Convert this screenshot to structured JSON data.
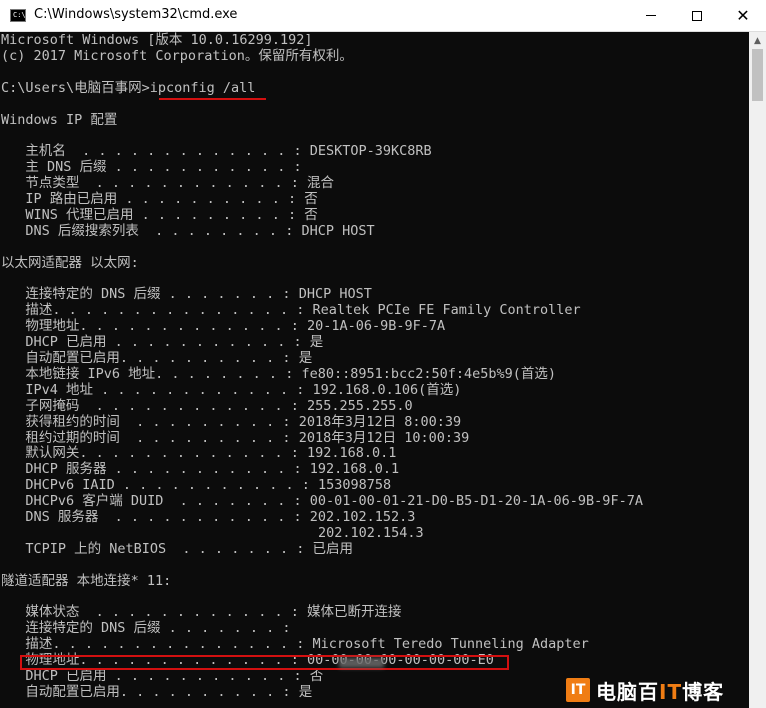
{
  "window": {
    "title": "C:\\Windows\\system32\\cmd.exe",
    "minimize_label": "—",
    "maximize_label": "☐",
    "close_label": "✕"
  },
  "console": {
    "lines": [
      "Microsoft Windows [版本 10.0.16299.192]",
      "(c) 2017 Microsoft Corporation。保留所有权利。",
      "",
      "C:\\Users\\电脑百事网>ipconfig /all",
      "",
      "Windows IP 配置",
      "",
      "   主机名  . . . . . . . . . . . . . : DESKTOP-39KC8RB",
      "   主 DNS 后缀 . . . . . . . . . . . :",
      "   节点类型  . . . . . . . . . . . . : 混合",
      "   IP 路由已启用 . . . . . . . . . . : 否",
      "   WINS 代理已启用 . . . . . . . . . : 否",
      "   DNS 后缀搜索列表  . . . . . . . . : DHCP HOST",
      "",
      "以太网适配器 以太网:",
      "",
      "   连接特定的 DNS 后缀 . . . . . . . : DHCP HOST",
      "   描述. . . . . . . . . . . . . . . : Realtek PCIe FE Family Controller",
      "   物理地址. . . . . . . . . . . . . : 20-1A-06-9B-9F-7A",
      "   DHCP 已启用 . . . . . . . . . . . : 是",
      "   自动配置已启用. . . . . . . . . . : 是",
      "   本地链接 IPv6 地址. . . . . . . . : fe80::8951:bcc2:50f:4e5b%9(首选)",
      "   IPv4 地址 . . . . . . . . . . . . : 192.168.0.106(首选)",
      "   子网掩码  . . . . . . . . . . . . : 255.255.255.0",
      "   获得租约的时间  . . . . . . . . . : 2018年3月12日 8:00:39",
      "   租约过期的时间  . . . . . . . . . : 2018年3月12日 10:00:39",
      "   默认网关. . . . . . . . . . . . . : 192.168.0.1",
      "   DHCP 服务器 . . . . . . . . . . . : 192.168.0.1",
      "   DHCPv6 IAID . . . . . . . . . . . : 153098758",
      "   DHCPv6 客户端 DUID  . . . . . . . : 00-01-00-01-21-D0-B5-D1-20-1A-06-9B-9F-7A",
      "   DNS 服务器  . . . . . . . . . . . : 202.102.152.3",
      "                                       202.102.154.3",
      "   TCPIP 上的 NetBIOS  . . . . . . . : 已启用",
      "",
      "隧道适配器 本地连接* 11:",
      "",
      "   媒体状态  . . . . . . . . . . . . : 媒体已断开连接",
      "   连接特定的 DNS 后缀 . . . . . . . :",
      "   描述. . . . . . . . . . . . . . . : Microsoft Teredo Tunneling Adapter",
      "   物理地址. . . . . . . . . . . . . : 00-00-00-00-00-00-00-E0",
      "   DHCP 已启用 . . . . . . . . . . . : 否",
      "   自动配置已启用. . . . . . . . . . : 是"
    ]
  },
  "watermark": {
    "logo": "IT",
    "text_prefix": "电脑百",
    "text_it": "IT",
    "text_suffix": "博客"
  },
  "colors": {
    "console_bg": "#0c0c0c",
    "console_fg": "#c0c0c0",
    "highlight": "#d31010",
    "watermark_accent": "#f07d14"
  }
}
